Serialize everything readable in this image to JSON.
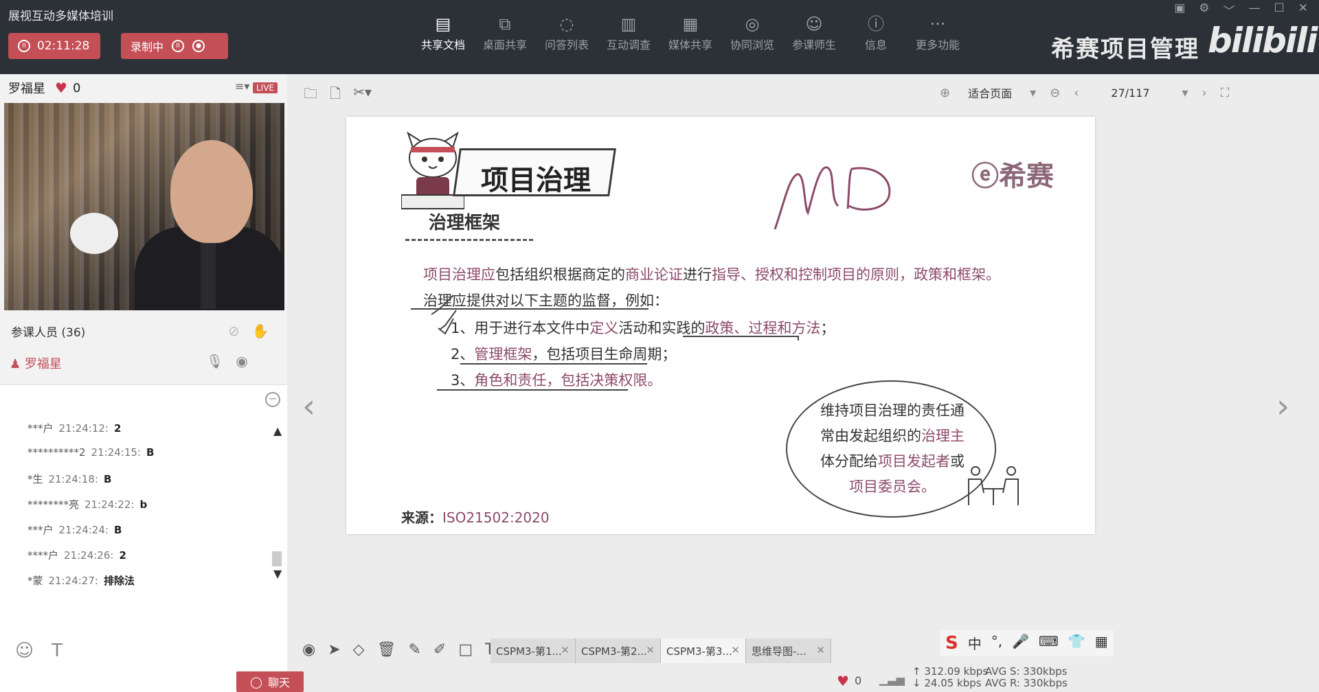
{
  "app": {
    "title": "展视互动多媒体培训",
    "timer": "02:11:28",
    "recording": "录制中",
    "brand": "希赛项目管理",
    "bili": "bilibili"
  },
  "toolbar": [
    {
      "label": "共享文档",
      "icon": "document-icon",
      "glyph": "▤"
    },
    {
      "label": "桌面共享",
      "icon": "desktop-share-icon",
      "glyph": "⧉"
    },
    {
      "label": "问答列表",
      "icon": "qa-icon",
      "glyph": "◌"
    },
    {
      "label": "互动调查",
      "icon": "survey-icon",
      "glyph": "▥"
    },
    {
      "label": "媒体共享",
      "icon": "media-icon",
      "glyph": "▦"
    },
    {
      "label": "协同浏览",
      "icon": "browse-icon",
      "glyph": "◎"
    },
    {
      "label": "参课师生",
      "icon": "people-icon",
      "glyph": "☺"
    },
    {
      "label": "信息",
      "icon": "info-icon",
      "glyph": "ⓘ"
    },
    {
      "label": "更多功能",
      "icon": "more-icon",
      "glyph": "···"
    }
  ],
  "presenter": {
    "name": "罗福星",
    "likes": "0",
    "live": "LIVE"
  },
  "attendees": {
    "label": "参课人员 (36)",
    "member": "罗福星"
  },
  "chat": {
    "messages": [
      {
        "user": "***户",
        "time": "21:24:12:",
        "text": "2"
      },
      {
        "user": "**********2",
        "time": "21:24:15:",
        "text": "B"
      },
      {
        "user": "*生",
        "time": "21:24:18:",
        "text": "B"
      },
      {
        "user": "********亮",
        "time": "21:24:22:",
        "text": "b"
      },
      {
        "user": "***户",
        "time": "21:24:24:",
        "text": "B"
      },
      {
        "user": "****户",
        "time": "21:24:26:",
        "text": "2"
      },
      {
        "user": "*蒙",
        "time": "21:24:27:",
        "text": "排除法"
      }
    ],
    "chat_button": "聊天"
  },
  "viewer": {
    "zoom": "适合页面",
    "page": "27/117"
  },
  "slide": {
    "title": "项目治理",
    "subtitle": "治理框架",
    "logo": "希赛",
    "line1_a": "项目治理应",
    "line1_b": "包括组织根据商定的",
    "line1_c": "商业论证",
    "line1_d": "进行",
    "line1_e": "指导、授权和控制项目的原则，政策和框架。",
    "line2_a": "治理应",
    "line2_b": "提供对以下主题的监督，例如：",
    "item1_a": "1、用于进行本文件中",
    "item1_b": "定义",
    "item1_c": "活动和实践的",
    "item1_d": "政策、过程和方法",
    "item1_e": "；",
    "item2_a": "2、",
    "item2_b": "管理框架",
    "item2_c": "，包括项目生命周期；",
    "item3_a": "3、",
    "item3_b": "角色和责任，包括决策权限。",
    "oval_1": "维持项目治理的责任通",
    "oval_2a": "常由发起组织的",
    "oval_2b": "治理主",
    "oval_3a": "体分配给",
    "oval_3b": "项目发起者",
    "oval_3c": "或",
    "oval_4": "项目委员会。",
    "source_label": "来源：",
    "source_value": "ISO21502:2020",
    "handwriting": "MD"
  },
  "doc_tabs": [
    "CSPM3-第1...",
    "CSPM3-第2...",
    "CSPM3-第3...",
    "思维导图-..."
  ],
  "status": {
    "likes": "0",
    "up": "312.09 kbps",
    "down": "24.05 kbps",
    "avg_s": "AVG S: 330kbps",
    "avg_r": "AVG R: 330kbps"
  },
  "ime": [
    "中",
    "°,",
    "🎤",
    "⌨",
    "👕",
    "▦"
  ]
}
